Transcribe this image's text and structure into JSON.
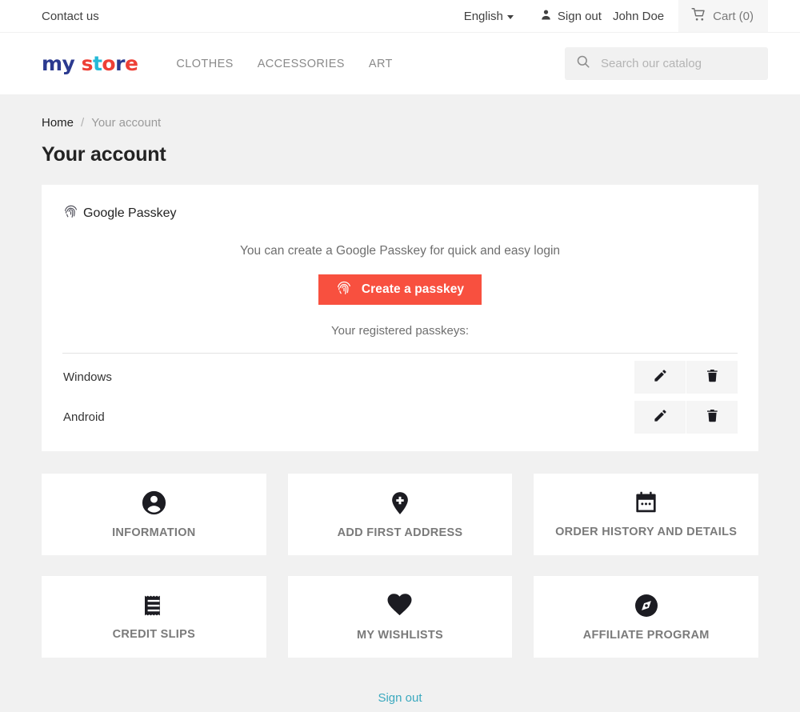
{
  "topbar": {
    "contact_label": "Contact us",
    "language": "English",
    "signout_label": "Sign out",
    "user_name": "John Doe",
    "cart_label": "Cart (0)",
    "icons": {
      "user": "user-icon",
      "cart": "cart-icon",
      "caret": "chevron-down-icon"
    }
  },
  "header": {
    "logo": {
      "part1": "my",
      "part2_s": "s",
      "part2_t": "t",
      "part2_o": "o",
      "part2_r": "r",
      "part2_e": "e"
    },
    "nav": [
      {
        "label": "CLOTHES"
      },
      {
        "label": "ACCESSORIES"
      },
      {
        "label": "ART"
      }
    ],
    "search": {
      "placeholder": "Search our catalog",
      "value": "",
      "icon": "search-icon"
    }
  },
  "breadcrumb": {
    "home": "Home",
    "separator": "/",
    "current": "Your account"
  },
  "page_title": "Your account",
  "passkey": {
    "heading": "Google Passkey",
    "heading_icon": "fingerprint-icon",
    "description": "You can create a Google Passkey for quick and easy login",
    "create_button": {
      "label": "Create a passkey",
      "icon": "fingerprint-icon",
      "color": "#f8503f"
    },
    "registered_label": "Your registered passkeys:",
    "rows": [
      {
        "name": "Windows",
        "edit_icon": "pencil-icon",
        "delete_icon": "trash-icon"
      },
      {
        "name": "Android",
        "edit_icon": "pencil-icon",
        "delete_icon": "trash-icon"
      }
    ]
  },
  "account_links": [
    {
      "label": "INFORMATION",
      "icon": "person-circle-icon"
    },
    {
      "label": "ADD FIRST ADDRESS",
      "icon": "map-pin-plus-icon"
    },
    {
      "label": "ORDER HISTORY AND DETAILS",
      "icon": "calendar-icon"
    },
    {
      "label": "CREDIT SLIPS",
      "icon": "receipt-icon"
    },
    {
      "label": "MY WISHLISTS",
      "icon": "heart-icon"
    },
    {
      "label": "AFFILIATE PROGRAM",
      "icon": "compass-icon"
    }
  ],
  "footer": {
    "signout_label": "Sign out",
    "link_color": "#3ba9bf"
  }
}
